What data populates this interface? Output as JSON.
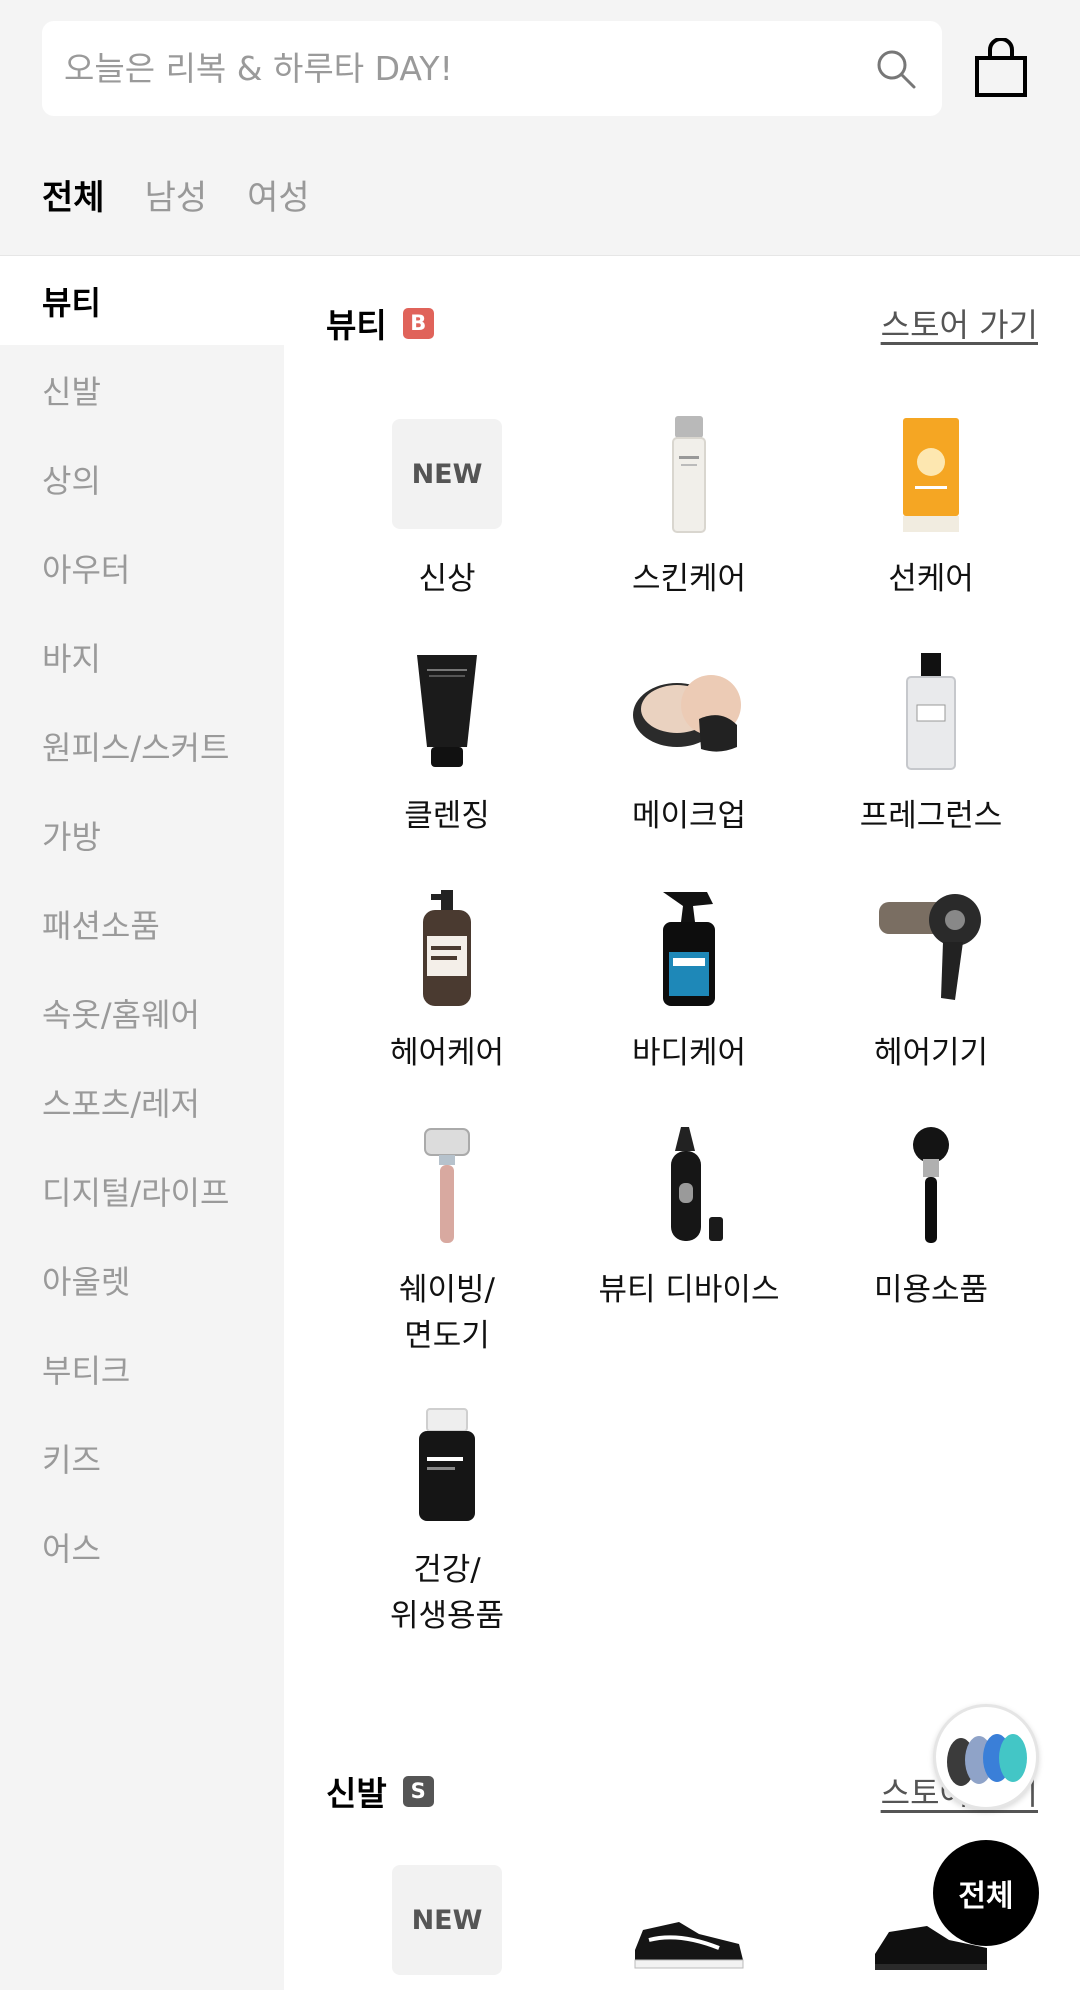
{
  "search": {
    "placeholder": "오늘은 리복 & 하루타 DAY!"
  },
  "gender_tabs": [
    {
      "label": "전체",
      "active": true
    },
    {
      "label": "남성",
      "active": false
    },
    {
      "label": "여성",
      "active": false
    }
  ],
  "sidebar": {
    "items": [
      {
        "label": "뷰티",
        "active": true
      },
      {
        "label": "신발"
      },
      {
        "label": "상의"
      },
      {
        "label": "아우터"
      },
      {
        "label": "바지"
      },
      {
        "label": "원피스/스커트"
      },
      {
        "label": "가방"
      },
      {
        "label": "패션소품"
      },
      {
        "label": "속옷/홈웨어"
      },
      {
        "label": "스포츠/레저"
      },
      {
        "label": "디지털/라이프"
      },
      {
        "label": "아울렛"
      },
      {
        "label": "부티크"
      },
      {
        "label": "키즈"
      },
      {
        "label": "어스"
      }
    ]
  },
  "sections": {
    "beauty": {
      "title": "뷰티",
      "badge": "B",
      "badge_color": "#e0635a",
      "store_link": "스토어 가기",
      "categories": [
        {
          "label": "신상",
          "icon": "new-icon",
          "new_text": "NEW"
        },
        {
          "label": "스킨케어",
          "icon": "skincare-bottle-icon"
        },
        {
          "label": "선케어",
          "icon": "sunscreen-icon"
        },
        {
          "label": "클렌징",
          "icon": "cleansing-tube-icon"
        },
        {
          "label": "메이크업",
          "icon": "cushion-compact-icon"
        },
        {
          "label": "프레그런스",
          "icon": "perfume-bottle-icon"
        },
        {
          "label": "헤어케어",
          "icon": "shampoo-pump-icon"
        },
        {
          "label": "바디케어",
          "icon": "spray-bottle-icon"
        },
        {
          "label": "헤어기기",
          "icon": "hair-dryer-icon"
        },
        {
          "label": "쉐이빙/\n면도기",
          "icon": "razor-icon"
        },
        {
          "label": "뷰티 디바이스",
          "icon": "trimmer-icon"
        },
        {
          "label": "미용소품",
          "icon": "makeup-brush-icon"
        },
        {
          "label": "건강/\n위생용품",
          "icon": "supplement-bottle-icon"
        }
      ]
    },
    "shoes": {
      "title": "신발",
      "badge": "S",
      "badge_color": "#555555",
      "store_link": "스토어 가기",
      "categories": [
        {
          "icon": "new-icon",
          "new_text": "NEW"
        },
        {
          "icon": "sneaker-icon"
        },
        {
          "icon": "dress-shoe-icon"
        }
      ]
    }
  },
  "floating": {
    "promo_icon": "mouse-promo-icon",
    "all_button": "전체"
  }
}
